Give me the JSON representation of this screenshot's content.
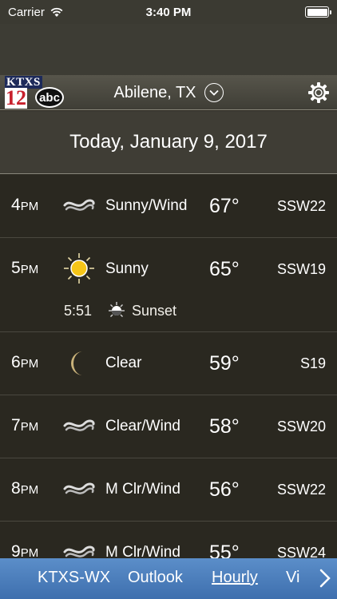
{
  "status_bar": {
    "carrier": "Carrier",
    "time": "3:40 PM"
  },
  "header": {
    "logo": {
      "station": "KTXS",
      "channel": "12",
      "network": "abc"
    },
    "location": "Abilene, TX"
  },
  "date_label": "Today, January 9, 2017",
  "hours": [
    {
      "hour": "4",
      "ampm": "PM",
      "icon": "wind-icon",
      "condition": "Sunny/Wind",
      "temp": "67°",
      "wind": "SSW22"
    },
    {
      "hour": "5",
      "ampm": "PM",
      "icon": "sun-icon",
      "condition": "Sunny",
      "temp": "65°",
      "wind": "SSW19"
    },
    {
      "hour": "6",
      "ampm": "PM",
      "icon": "moon-icon",
      "condition": "Clear",
      "temp": "59°",
      "wind": "S19"
    },
    {
      "hour": "7",
      "ampm": "PM",
      "icon": "wind-icon",
      "condition": "Clear/Wind",
      "temp": "58°",
      "wind": "SSW20"
    },
    {
      "hour": "8",
      "ampm": "PM",
      "icon": "wind-icon",
      "condition": "M Clr/Wind",
      "temp": "56°",
      "wind": "SSW22"
    },
    {
      "hour": "9",
      "ampm": "PM",
      "icon": "wind-icon",
      "condition": "M Clr/Wind",
      "temp": "55°",
      "wind": "SSW24"
    }
  ],
  "sunset": {
    "time": "5:51",
    "label": "Sunset"
  },
  "nav": {
    "items": [
      "KTXS-WX",
      "Outlook",
      "Hourly",
      "Vi"
    ],
    "active": "Hourly"
  },
  "colors": {
    "nav_blue": "#4a7dbd",
    "sun_yellow": "#f5c518",
    "moon": "#c9b27a"
  }
}
